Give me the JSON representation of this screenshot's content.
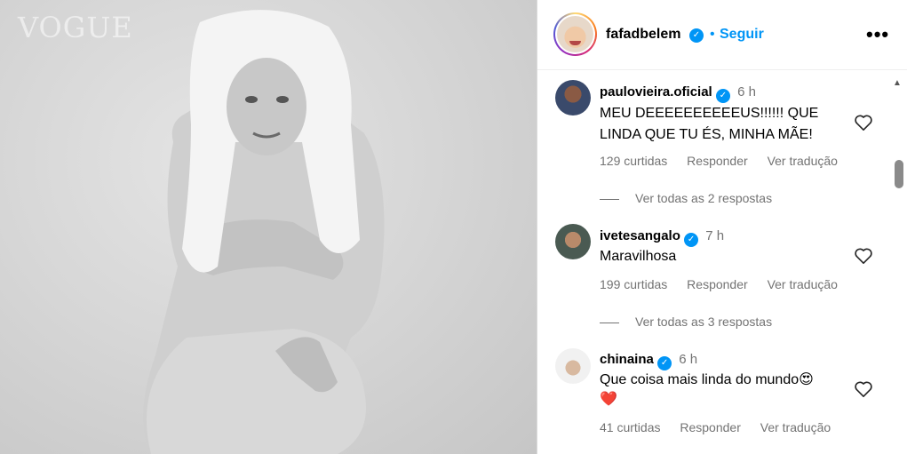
{
  "photo": {
    "watermark": "VOGUE"
  },
  "header": {
    "username": "fafadbelem",
    "separator": "•",
    "follow_label": "Seguir",
    "more_label": "•••"
  },
  "comments": [
    {
      "username": "paulovieira.oficial",
      "time": "6 h",
      "text": "MEU DEEEEEEEEEEUS!!!!!! QUE LINDA QUE TU ÉS, MINHA MÃE!",
      "likes": "129 curtidas",
      "reply_label": "Responder",
      "translate_label": "Ver tradução",
      "view_replies": "Ver todas as 2 respostas"
    },
    {
      "username": "ivetesangalo",
      "time": "7 h",
      "text": "Maravilhosa",
      "likes": "199 curtidas",
      "reply_label": "Responder",
      "translate_label": "Ver tradução",
      "view_replies": "Ver todas as 3 respostas"
    },
    {
      "username": "chinaina",
      "time": "6 h",
      "text": "Que coisa mais linda do mundo😍",
      "text_line2": "❤️",
      "likes": "41 curtidas",
      "reply_label": "Responder",
      "translate_label": "Ver tradução"
    }
  ],
  "colors": {
    "accent": "#0095f6",
    "muted": "#737373"
  },
  "icons": [
    "verified-badge-icon",
    "heart-icon",
    "more-options-icon",
    "scroll-up-icon"
  ]
}
